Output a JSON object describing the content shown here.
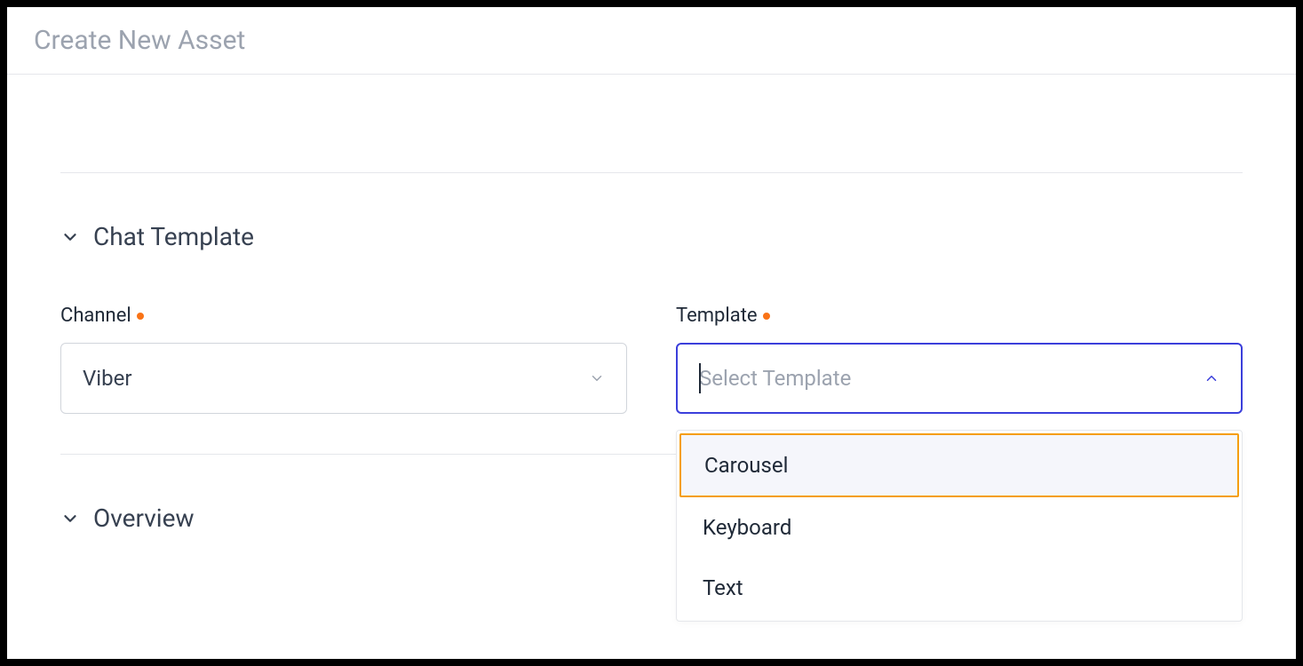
{
  "header": {
    "title": "Create New Asset"
  },
  "sections": {
    "chat_template": {
      "title": "Chat Template",
      "fields": {
        "channel": {
          "label": "Channel",
          "value": "Viber"
        },
        "template": {
          "label": "Template",
          "placeholder": "Select Template",
          "options": [
            "Carousel",
            "Keyboard",
            "Text"
          ]
        }
      }
    },
    "overview": {
      "title": "Overview"
    }
  }
}
